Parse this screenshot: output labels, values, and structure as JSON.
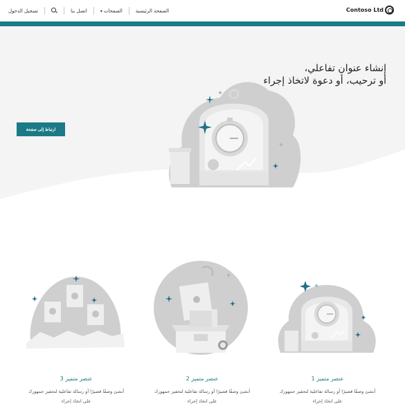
{
  "header": {
    "logo_text": "Contoso Ltd",
    "nav": {
      "home": "الصفحة الرئيسية",
      "pages": "الصفحات",
      "contact": "اتصل بنا",
      "signin": "تسجيل الدخول"
    }
  },
  "hero": {
    "title_line1": "إنشاء عنوان تفاعلي،",
    "title_line2": "أو ترحيب، أو دعوة لاتخاذ إجراء",
    "button_label": "ارتباط إلى صفحة"
  },
  "features": [
    {
      "title": "عنصر متميز 1",
      "desc_line1": "أنشئ وصفًا قصيرًا أو رسالة تفاعلية لتحفيز جمهورك",
      "desc_line2": "على اتخاذ إجراء"
    },
    {
      "title": "عنصر متميز 2",
      "desc_line1": "أنشئ وصفًا قصيرًا أو رسالة تفاعلية لتحفيز جمهورك",
      "desc_line2": "على اتخاذ إجراء"
    },
    {
      "title": "عنصر متميز 3",
      "desc_line1": "أنشئ وصفًا قصيرًا أو رسالة تفاعلية لتحفيز جمهورك",
      "desc_line2": "على اتخاذ إجراء"
    }
  ],
  "colors": {
    "accent": "#1b7a86",
    "sparkle": "#1f6f8b",
    "art_gray": "#cfcfcf"
  }
}
